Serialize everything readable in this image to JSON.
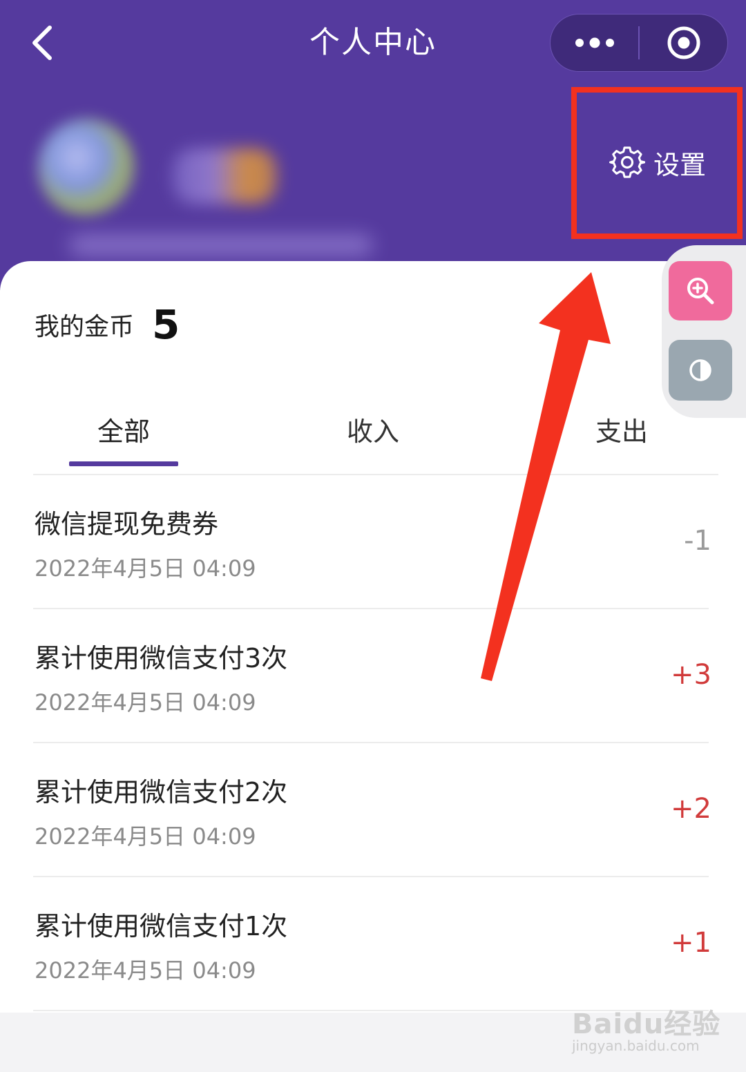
{
  "header": {
    "title": "个人中心",
    "back_icon": "chevron-left-icon",
    "more_icon": "more-dots-icon",
    "close_icon": "target-circle-icon",
    "bg_color": "#553a9e"
  },
  "settings": {
    "label": "设置",
    "icon": "gear-icon"
  },
  "coins": {
    "label": "我的金币",
    "value": "5"
  },
  "float_tools": {
    "zoom_icon": "zoom-in-icon",
    "contrast_icon": "contrast-icon"
  },
  "tabs": [
    {
      "label": "全部",
      "active": true
    },
    {
      "label": "收入",
      "active": false
    },
    {
      "label": "支出",
      "active": false
    }
  ],
  "records": [
    {
      "title": "微信提现免费券",
      "time": "2022年4月5日 04:09",
      "amount": "-1"
    },
    {
      "title": "累计使用微信支付3次",
      "time": "2022年4月5日 04:09",
      "amount": "+3"
    },
    {
      "title": "累计使用微信支付2次",
      "time": "2022年4月5日 04:09",
      "amount": "+2"
    },
    {
      "title": "累计使用微信支付1次",
      "time": "2022年4月5日 04:09",
      "amount": "+1"
    }
  ],
  "watermark": {
    "brand": "Baidu经验",
    "url": "jingyan.baidu.com"
  },
  "colors": {
    "accent": "#553a9e",
    "highlight": "#f3311f",
    "positive": "#d13b3b",
    "negative": "#9a9a9a"
  }
}
